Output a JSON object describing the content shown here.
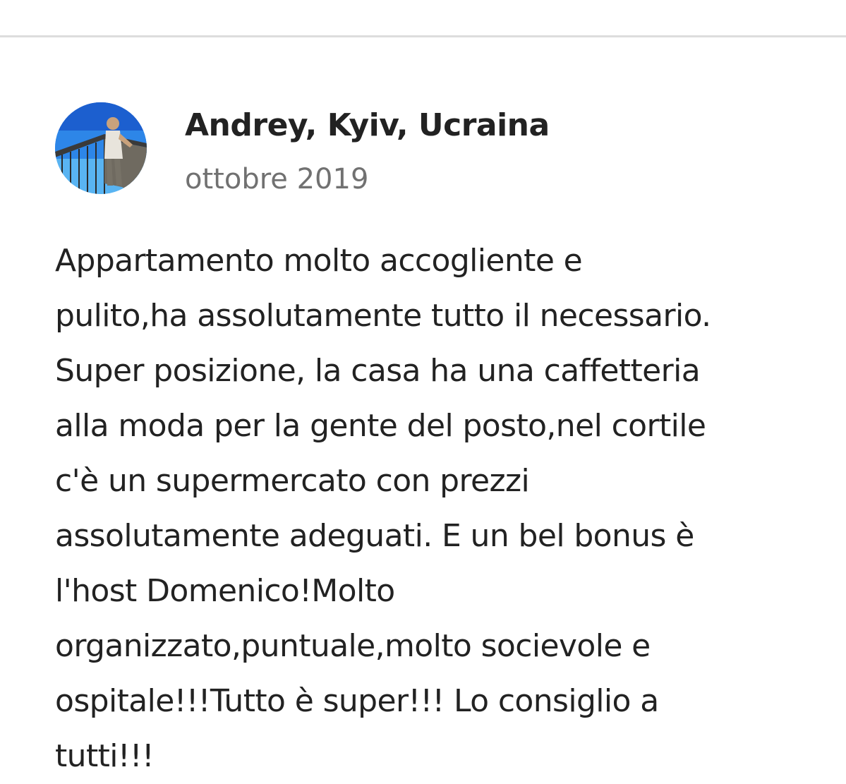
{
  "review": {
    "reviewer_name": "Andrey, Kyiv, Ucraina",
    "date": "ottobre 2019",
    "avatar": "profile-photo",
    "text_lines": [
      "Appartamento molto accogliente e",
      "pulito,ha assolutamente tutto il necessario.",
      "Super posizione, la casa ha una caffetteria",
      "alla moda per la gente del posto,nel cortile",
      "c'è un supermercato con prezzi",
      "assolutamente adeguati. E un bel bonus è",
      "l'host Domenico!Molto",
      "organizzato,puntuale,molto socievole e",
      "ospitale!!!Tutto è super!!! Lo consiglio a",
      "tutti!!!"
    ]
  }
}
